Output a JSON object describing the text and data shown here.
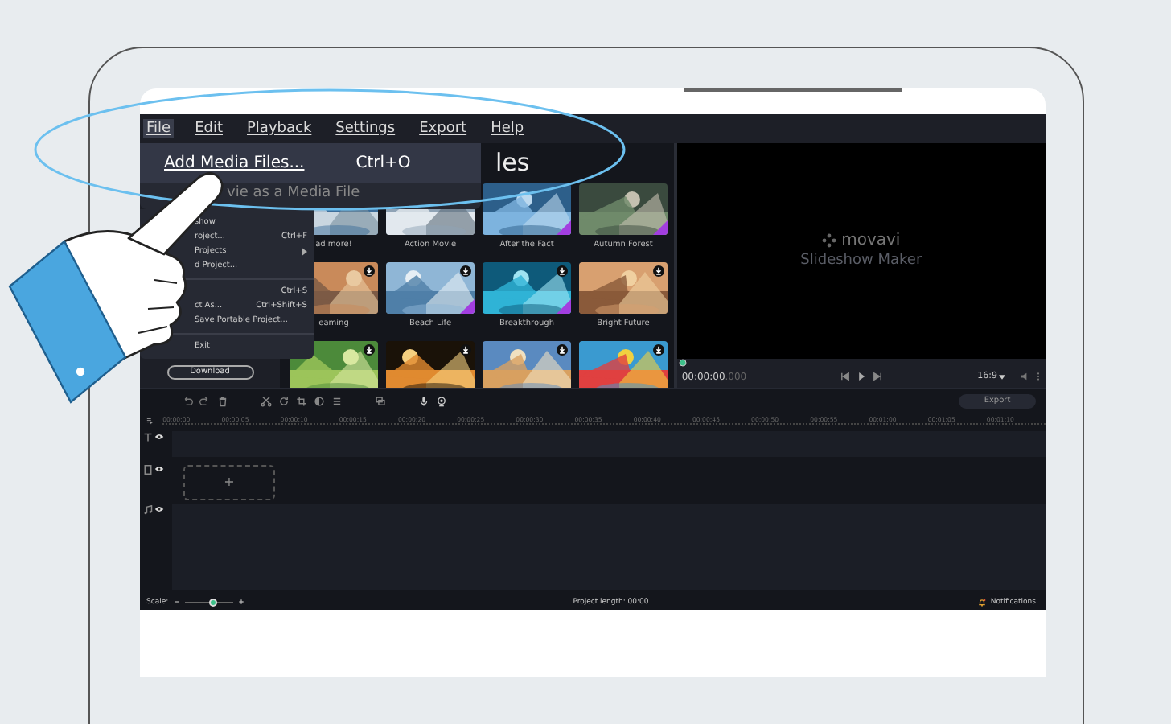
{
  "menu": [
    {
      "label": "File",
      "selected": true
    },
    {
      "label": "Edit",
      "selected": false
    },
    {
      "label": "Playback",
      "selected": false
    },
    {
      "label": "Settings",
      "selected": false
    },
    {
      "label": "Export",
      "selected": false
    },
    {
      "label": "Help",
      "selected": false
    }
  ],
  "file_menu": {
    "highlighted": {
      "label": "Add Media Files...",
      "shortcut": "Ctrl+O"
    },
    "zoomed_item": "vie as a Media File",
    "items": [
      {
        "kind": "item",
        "label": "show"
      },
      {
        "kind": "item",
        "label": "roject...",
        "shortcut": "Ctrl+F"
      },
      {
        "kind": "item",
        "label": "Projects",
        "submenu": true
      },
      {
        "kind": "item",
        "label": "d Project..."
      },
      {
        "kind": "separator"
      },
      {
        "kind": "item",
        "shortcut": "Ctrl+S"
      },
      {
        "kind": "item",
        "label": "ct As...",
        "shortcut": "Ctrl+Shift+S"
      },
      {
        "kind": "item",
        "label": "Save Portable Project..."
      },
      {
        "kind": "separator"
      },
      {
        "kind": "item",
        "label": "Exit"
      }
    ]
  },
  "media": {
    "title": "les",
    "download_button": "Download",
    "items": [
      {
        "caption": "ad more!",
        "new": false,
        "downloadable": false
      },
      {
        "caption": "Action Movie",
        "new": false,
        "downloadable": false
      },
      {
        "caption": "After the Fact",
        "new": true,
        "downloadable": false
      },
      {
        "caption": "Autumn Forest",
        "new": true,
        "downloadable": false
      },
      {
        "caption": "eaming",
        "new": false,
        "downloadable": true
      },
      {
        "caption": "Beach Life",
        "new": true,
        "downloadable": true
      },
      {
        "caption": "Breakthrough",
        "new": true,
        "downloadable": true
      },
      {
        "caption": "Bright Future",
        "new": false,
        "downloadable": true
      },
      {
        "new": false,
        "downloadable": true
      },
      {
        "new": false,
        "downloadable": true
      },
      {
        "new": false,
        "downloadable": true
      },
      {
        "new": false,
        "downloadable": true
      }
    ]
  },
  "preview": {
    "logo": "movavi",
    "subtitle": "Slideshow Maker",
    "time": "00:00:00",
    "time_fraction": ".000",
    "aspect": "16:9"
  },
  "toolbar": {
    "export": "Export"
  },
  "timeline": {
    "ruler": [
      "00:00:00",
      "00:00:05",
      "00:00:10",
      "00:00:15",
      "00:00:20",
      "00:00:25",
      "00:00:30",
      "00:00:35",
      "00:00:40",
      "00:00:45",
      "00:00:50",
      "00:00:55",
      "00:01:00",
      "00:01:05",
      "00:01:10"
    ],
    "tracks": [
      {
        "kind": "text"
      },
      {
        "kind": "video"
      },
      {
        "kind": "audio"
      }
    ],
    "add_label": "+"
  },
  "status": {
    "scale_label": "Scale:",
    "level": 0.6,
    "project_length": "Project length: 00:00",
    "notifications": "Notifications"
  }
}
